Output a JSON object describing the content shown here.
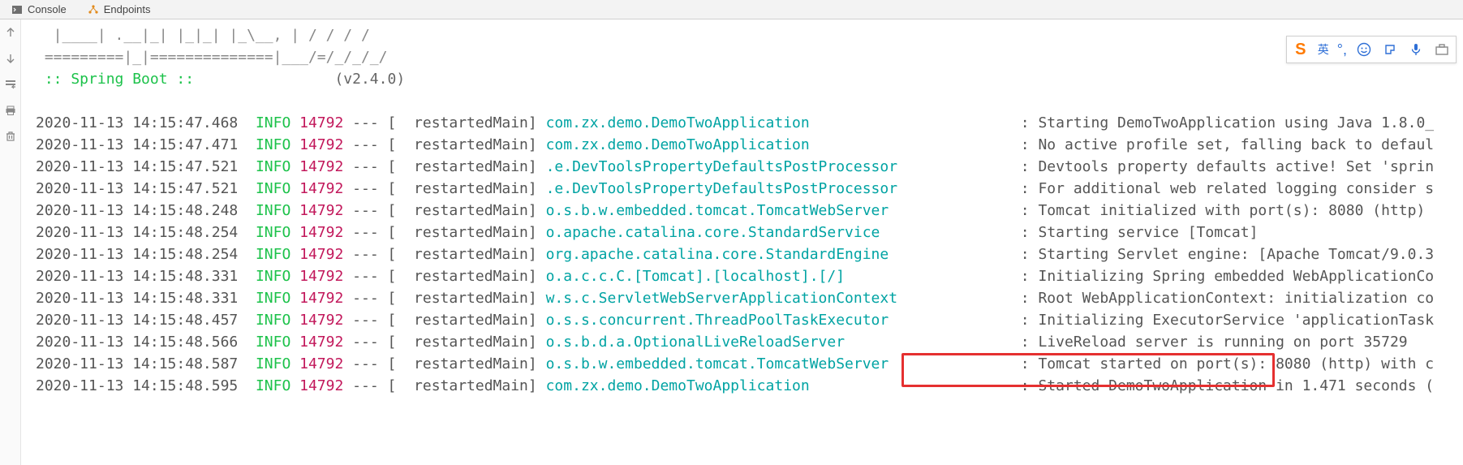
{
  "tabs": {
    "console": "Console",
    "endpoints": "Endpoints"
  },
  "ascii": {
    "line1": "  |____| .__|_| |_|_| |_\\__, | / / / /",
    "line2": " =========|_|==============|___/=/_/_/_/"
  },
  "spring": {
    "label": " :: Spring Boot :: ",
    "version": "               (v2.4.0)"
  },
  "lang_indicator": "英",
  "logs": [
    {
      "ts": "2020-11-13 14:15:47.468",
      "level": "INFO",
      "pid": "14792",
      "thread": "restartedMain",
      "logger": "com.zx.demo.DemoTwoApplication",
      "logger_pad": "                        ",
      "msg": "Starting DemoTwoApplication using Java 1.8.0_"
    },
    {
      "ts": "2020-11-13 14:15:47.471",
      "level": "INFO",
      "pid": "14792",
      "thread": "restartedMain",
      "logger": "com.zx.demo.DemoTwoApplication",
      "logger_pad": "                        ",
      "msg": "No active profile set, falling back to defaul"
    },
    {
      "ts": "2020-11-13 14:15:47.521",
      "level": "INFO",
      "pid": "14792",
      "thread": "restartedMain",
      "logger": ".e.DevToolsPropertyDefaultsPostProcessor",
      "logger_pad": "              ",
      "msg": "Devtools property defaults active! Set 'sprin"
    },
    {
      "ts": "2020-11-13 14:15:47.521",
      "level": "INFO",
      "pid": "14792",
      "thread": "restartedMain",
      "logger": ".e.DevToolsPropertyDefaultsPostProcessor",
      "logger_pad": "              ",
      "msg": "For additional web related logging consider s"
    },
    {
      "ts": "2020-11-13 14:15:48.248",
      "level": "INFO",
      "pid": "14792",
      "thread": "restartedMain",
      "logger": "o.s.b.w.embedded.tomcat.TomcatWebServer",
      "logger_pad": "               ",
      "msg": "Tomcat initialized with port(s): 8080 (http)"
    },
    {
      "ts": "2020-11-13 14:15:48.254",
      "level": "INFO",
      "pid": "14792",
      "thread": "restartedMain",
      "logger": "o.apache.catalina.core.StandardService",
      "logger_pad": "                ",
      "msg": "Starting service [Tomcat]"
    },
    {
      "ts": "2020-11-13 14:15:48.254",
      "level": "INFO",
      "pid": "14792",
      "thread": "restartedMain",
      "logger": "org.apache.catalina.core.StandardEngine",
      "logger_pad": "               ",
      "msg": "Starting Servlet engine: [Apache Tomcat/9.0.3"
    },
    {
      "ts": "2020-11-13 14:15:48.331",
      "level": "INFO",
      "pid": "14792",
      "thread": "restartedMain",
      "logger": "o.a.c.c.C.[Tomcat].[localhost].[/]",
      "logger_pad": "                    ",
      "msg": "Initializing Spring embedded WebApplicationCo"
    },
    {
      "ts": "2020-11-13 14:15:48.331",
      "level": "INFO",
      "pid": "14792",
      "thread": "restartedMain",
      "logger": "w.s.c.ServletWebServerApplicationContext",
      "logger_pad": "              ",
      "msg": "Root WebApplicationContext: initialization co"
    },
    {
      "ts": "2020-11-13 14:15:48.457",
      "level": "INFO",
      "pid": "14792",
      "thread": "restartedMain",
      "logger": "o.s.s.concurrent.ThreadPoolTaskExecutor",
      "logger_pad": "               ",
      "msg": "Initializing ExecutorService 'applicationTask"
    },
    {
      "ts": "2020-11-13 14:15:48.566",
      "level": "INFO",
      "pid": "14792",
      "thread": "restartedMain",
      "logger": "o.s.b.d.a.OptionalLiveReloadServer",
      "logger_pad": "                    ",
      "msg": "LiveReload server is running on port 35729"
    },
    {
      "ts": "2020-11-13 14:15:48.587",
      "level": "INFO",
      "pid": "14792",
      "thread": "restartedMain",
      "logger": "o.s.b.w.embedded.tomcat.TomcatWebServer",
      "logger_pad": "               ",
      "msg": "Tomcat started on port(s): 8080 (http) with c"
    },
    {
      "ts": "2020-11-13 14:15:48.595",
      "level": "INFO",
      "pid": "14792",
      "thread": "restartedMain",
      "logger": "com.zx.demo.DemoTwoApplication",
      "logger_pad": "                        ",
      "msg": "Started DemoTwoApplication in 1.471 seconds ("
    }
  ]
}
